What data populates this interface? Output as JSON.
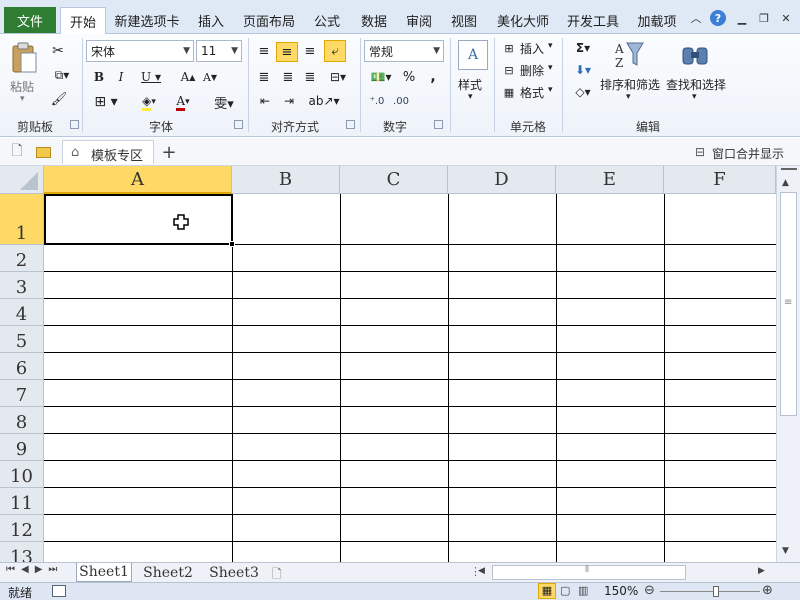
{
  "tabs": {
    "file": "文件",
    "items": [
      "开始",
      "新建选项卡",
      "插入",
      "页面布局",
      "公式",
      "数据",
      "审阅",
      "视图",
      "美化大师",
      "开发工具",
      "加载项"
    ]
  },
  "clipboard": {
    "paste": "粘贴",
    "group": "剪贴板"
  },
  "font": {
    "name": "宋体",
    "size": "11",
    "group": "字体"
  },
  "alignment": {
    "group": "对齐方式"
  },
  "number": {
    "format": "常规",
    "group": "数字",
    "percent": "%",
    "comma": ","
  },
  "styles": {
    "label": "样式"
  },
  "cells": {
    "insert": "插入",
    "delete": "删除",
    "format": "格式",
    "group": "单元格"
  },
  "editing": {
    "sort": "排序和筛选",
    "find": "查找和选择",
    "group": "编辑"
  },
  "tabbar": {
    "template": "模板专区",
    "add": "+",
    "merge": "窗口合并显示"
  },
  "columns": [
    "A",
    "B",
    "C",
    "D",
    "E",
    "F"
  ],
  "rows": [
    "1",
    "2",
    "3",
    "4",
    "5",
    "6",
    "7",
    "8",
    "9",
    "10",
    "11",
    "12",
    "13"
  ],
  "sheets": [
    "Sheet1",
    "Sheet2",
    "Sheet3"
  ],
  "status": {
    "ready": "就绪",
    "zoom": "150%"
  },
  "colors": {
    "file_tab": "#2e7d32",
    "selected_header": "#ffd966",
    "ribbon": "#eef3fa"
  }
}
